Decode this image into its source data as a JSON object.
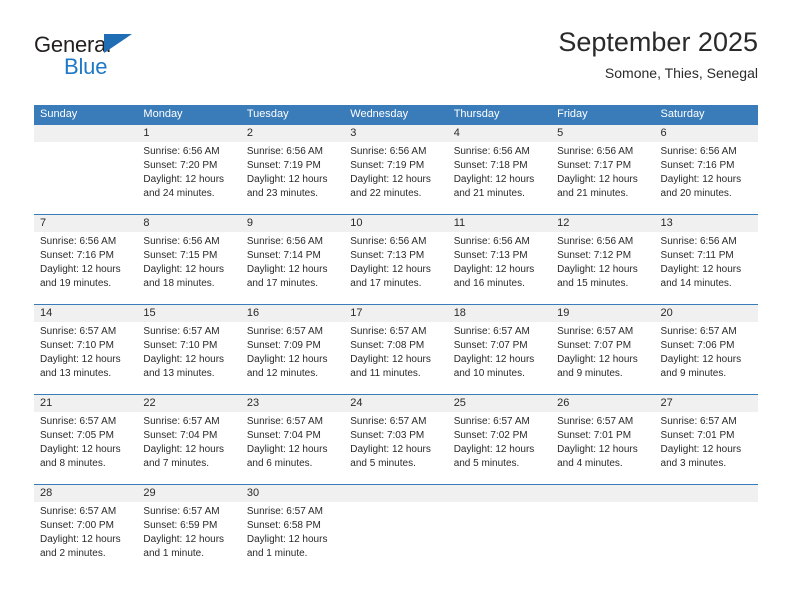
{
  "brand": {
    "name_top": "General",
    "name_bottom": "Blue",
    "accent_color": "#2079c6",
    "triangle_color": "#1f6db5"
  },
  "header": {
    "title": "September 2025",
    "subtitle": "Somone, Thies, Senegal"
  },
  "calendar": {
    "header_color": "#3a7cb9",
    "day_band_color": "#f0f0f0",
    "weekdays": [
      "Sunday",
      "Monday",
      "Tuesday",
      "Wednesday",
      "Thursday",
      "Friday",
      "Saturday"
    ],
    "weeks": [
      [
        {
          "day": "",
          "sunrise": "",
          "sunset": "",
          "daylight_line1": "",
          "daylight_line2": ""
        },
        {
          "day": "1",
          "sunrise": "Sunrise: 6:56 AM",
          "sunset": "Sunset: 7:20 PM",
          "daylight_line1": "Daylight: 12 hours",
          "daylight_line2": "and 24 minutes."
        },
        {
          "day": "2",
          "sunrise": "Sunrise: 6:56 AM",
          "sunset": "Sunset: 7:19 PM",
          "daylight_line1": "Daylight: 12 hours",
          "daylight_line2": "and 23 minutes."
        },
        {
          "day": "3",
          "sunrise": "Sunrise: 6:56 AM",
          "sunset": "Sunset: 7:19 PM",
          "daylight_line1": "Daylight: 12 hours",
          "daylight_line2": "and 22 minutes."
        },
        {
          "day": "4",
          "sunrise": "Sunrise: 6:56 AM",
          "sunset": "Sunset: 7:18 PM",
          "daylight_line1": "Daylight: 12 hours",
          "daylight_line2": "and 21 minutes."
        },
        {
          "day": "5",
          "sunrise": "Sunrise: 6:56 AM",
          "sunset": "Sunset: 7:17 PM",
          "daylight_line1": "Daylight: 12 hours",
          "daylight_line2": "and 21 minutes."
        },
        {
          "day": "6",
          "sunrise": "Sunrise: 6:56 AM",
          "sunset": "Sunset: 7:16 PM",
          "daylight_line1": "Daylight: 12 hours",
          "daylight_line2": "and 20 minutes."
        }
      ],
      [
        {
          "day": "7",
          "sunrise": "Sunrise: 6:56 AM",
          "sunset": "Sunset: 7:16 PM",
          "daylight_line1": "Daylight: 12 hours",
          "daylight_line2": "and 19 minutes."
        },
        {
          "day": "8",
          "sunrise": "Sunrise: 6:56 AM",
          "sunset": "Sunset: 7:15 PM",
          "daylight_line1": "Daylight: 12 hours",
          "daylight_line2": "and 18 minutes."
        },
        {
          "day": "9",
          "sunrise": "Sunrise: 6:56 AM",
          "sunset": "Sunset: 7:14 PM",
          "daylight_line1": "Daylight: 12 hours",
          "daylight_line2": "and 17 minutes."
        },
        {
          "day": "10",
          "sunrise": "Sunrise: 6:56 AM",
          "sunset": "Sunset: 7:13 PM",
          "daylight_line1": "Daylight: 12 hours",
          "daylight_line2": "and 17 minutes."
        },
        {
          "day": "11",
          "sunrise": "Sunrise: 6:56 AM",
          "sunset": "Sunset: 7:13 PM",
          "daylight_line1": "Daylight: 12 hours",
          "daylight_line2": "and 16 minutes."
        },
        {
          "day": "12",
          "sunrise": "Sunrise: 6:56 AM",
          "sunset": "Sunset: 7:12 PM",
          "daylight_line1": "Daylight: 12 hours",
          "daylight_line2": "and 15 minutes."
        },
        {
          "day": "13",
          "sunrise": "Sunrise: 6:56 AM",
          "sunset": "Sunset: 7:11 PM",
          "daylight_line1": "Daylight: 12 hours",
          "daylight_line2": "and 14 minutes."
        }
      ],
      [
        {
          "day": "14",
          "sunrise": "Sunrise: 6:57 AM",
          "sunset": "Sunset: 7:10 PM",
          "daylight_line1": "Daylight: 12 hours",
          "daylight_line2": "and 13 minutes."
        },
        {
          "day": "15",
          "sunrise": "Sunrise: 6:57 AM",
          "sunset": "Sunset: 7:10 PM",
          "daylight_line1": "Daylight: 12 hours",
          "daylight_line2": "and 13 minutes."
        },
        {
          "day": "16",
          "sunrise": "Sunrise: 6:57 AM",
          "sunset": "Sunset: 7:09 PM",
          "daylight_line1": "Daylight: 12 hours",
          "daylight_line2": "and 12 minutes."
        },
        {
          "day": "17",
          "sunrise": "Sunrise: 6:57 AM",
          "sunset": "Sunset: 7:08 PM",
          "daylight_line1": "Daylight: 12 hours",
          "daylight_line2": "and 11 minutes."
        },
        {
          "day": "18",
          "sunrise": "Sunrise: 6:57 AM",
          "sunset": "Sunset: 7:07 PM",
          "daylight_line1": "Daylight: 12 hours",
          "daylight_line2": "and 10 minutes."
        },
        {
          "day": "19",
          "sunrise": "Sunrise: 6:57 AM",
          "sunset": "Sunset: 7:07 PM",
          "daylight_line1": "Daylight: 12 hours",
          "daylight_line2": "and 9 minutes."
        },
        {
          "day": "20",
          "sunrise": "Sunrise: 6:57 AM",
          "sunset": "Sunset: 7:06 PM",
          "daylight_line1": "Daylight: 12 hours",
          "daylight_line2": "and 9 minutes."
        }
      ],
      [
        {
          "day": "21",
          "sunrise": "Sunrise: 6:57 AM",
          "sunset": "Sunset: 7:05 PM",
          "daylight_line1": "Daylight: 12 hours",
          "daylight_line2": "and 8 minutes."
        },
        {
          "day": "22",
          "sunrise": "Sunrise: 6:57 AM",
          "sunset": "Sunset: 7:04 PM",
          "daylight_line1": "Daylight: 12 hours",
          "daylight_line2": "and 7 minutes."
        },
        {
          "day": "23",
          "sunrise": "Sunrise: 6:57 AM",
          "sunset": "Sunset: 7:04 PM",
          "daylight_line1": "Daylight: 12 hours",
          "daylight_line2": "and 6 minutes."
        },
        {
          "day": "24",
          "sunrise": "Sunrise: 6:57 AM",
          "sunset": "Sunset: 7:03 PM",
          "daylight_line1": "Daylight: 12 hours",
          "daylight_line2": "and 5 minutes."
        },
        {
          "day": "25",
          "sunrise": "Sunrise: 6:57 AM",
          "sunset": "Sunset: 7:02 PM",
          "daylight_line1": "Daylight: 12 hours",
          "daylight_line2": "and 5 minutes."
        },
        {
          "day": "26",
          "sunrise": "Sunrise: 6:57 AM",
          "sunset": "Sunset: 7:01 PM",
          "daylight_line1": "Daylight: 12 hours",
          "daylight_line2": "and 4 minutes."
        },
        {
          "day": "27",
          "sunrise": "Sunrise: 6:57 AM",
          "sunset": "Sunset: 7:01 PM",
          "daylight_line1": "Daylight: 12 hours",
          "daylight_line2": "and 3 minutes."
        }
      ],
      [
        {
          "day": "28",
          "sunrise": "Sunrise: 6:57 AM",
          "sunset": "Sunset: 7:00 PM",
          "daylight_line1": "Daylight: 12 hours",
          "daylight_line2": "and 2 minutes."
        },
        {
          "day": "29",
          "sunrise": "Sunrise: 6:57 AM",
          "sunset": "Sunset: 6:59 PM",
          "daylight_line1": "Daylight: 12 hours",
          "daylight_line2": "and 1 minute."
        },
        {
          "day": "30",
          "sunrise": "Sunrise: 6:57 AM",
          "sunset": "Sunset: 6:58 PM",
          "daylight_line1": "Daylight: 12 hours",
          "daylight_line2": "and 1 minute."
        },
        {
          "day": "",
          "sunrise": "",
          "sunset": "",
          "daylight_line1": "",
          "daylight_line2": ""
        },
        {
          "day": "",
          "sunrise": "",
          "sunset": "",
          "daylight_line1": "",
          "daylight_line2": ""
        },
        {
          "day": "",
          "sunrise": "",
          "sunset": "",
          "daylight_line1": "",
          "daylight_line2": ""
        },
        {
          "day": "",
          "sunrise": "",
          "sunset": "",
          "daylight_line1": "",
          "daylight_line2": ""
        }
      ]
    ]
  }
}
